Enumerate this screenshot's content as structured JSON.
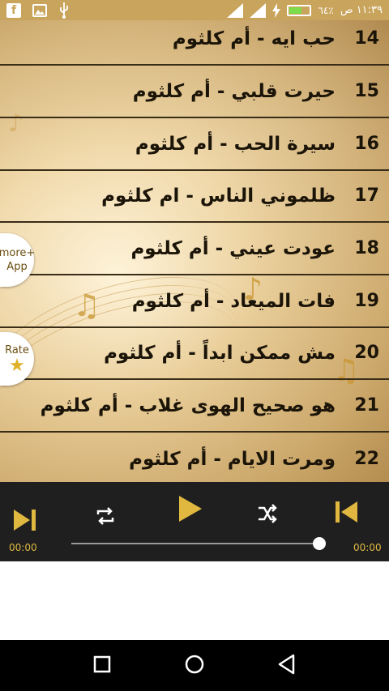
{
  "status_bar": {
    "time": "١١:٣٩ ص",
    "battery_percent": "٦٤٪",
    "battery_level": 0.64,
    "icons": [
      "facebook-icon",
      "image-icon",
      "usb-icon",
      "signal-icon",
      "wifi-icon",
      "charging-icon",
      "battery-icon"
    ]
  },
  "songs": [
    {
      "number": "14",
      "title": "حب ايه - أم كلثوم"
    },
    {
      "number": "15",
      "title": "حيرت قلبي - أم كلثوم"
    },
    {
      "number": "16",
      "title": "سيرة الحب - أم كلثوم"
    },
    {
      "number": "17",
      "title": "ظلموني الناس - ام كلثوم"
    },
    {
      "number": "18",
      "title": "عودت عيني - أم كلثوم"
    },
    {
      "number": "19",
      "title": "فات الميعاد - أم كلثوم"
    },
    {
      "number": "20",
      "title": "مش ممكن ابداً - أم كلثوم"
    },
    {
      "number": "21",
      "title": "هو صحيح الهوى غلاب - أم كلثوم"
    },
    {
      "number": "22",
      "title": "ومرت الايام - أم كلثوم"
    }
  ],
  "floating_buttons": {
    "more_app": {
      "line1": "more+",
      "line2": "App"
    },
    "rate": {
      "label": "Rate",
      "icon": "star-icon"
    }
  },
  "player": {
    "current_time": "00:00",
    "total_time": "00:00",
    "progress": 1.0,
    "controls": [
      "skip-next-icon",
      "repeat-icon",
      "play-icon",
      "shuffle-icon",
      "skip-previous-icon"
    ],
    "accent_color": "#e0b840"
  },
  "nav_bar": {
    "icons": [
      "recent-apps-icon",
      "home-icon",
      "back-icon"
    ]
  }
}
